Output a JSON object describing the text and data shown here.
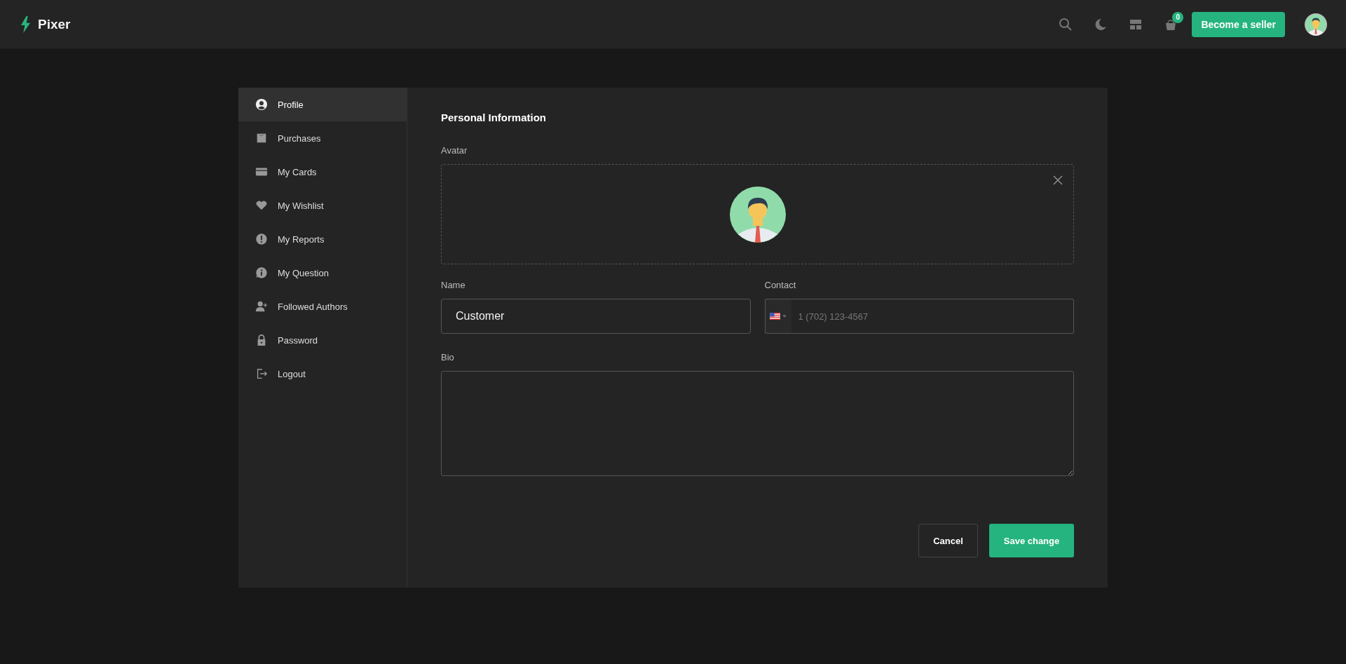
{
  "header": {
    "brand": "Pixer",
    "cart_count": "0",
    "seller_button": "Become a seller"
  },
  "sidebar": {
    "items": [
      {
        "label": "Profile",
        "selected": true
      },
      {
        "label": "Purchases",
        "selected": false
      },
      {
        "label": "My Cards",
        "selected": false
      },
      {
        "label": "My Wishlist",
        "selected": false
      },
      {
        "label": "My Reports",
        "selected": false
      },
      {
        "label": "My Question",
        "selected": false
      },
      {
        "label": "Followed Authors",
        "selected": false
      },
      {
        "label": "Password",
        "selected": false
      },
      {
        "label": "Logout",
        "selected": false
      }
    ]
  },
  "form": {
    "title": "Personal Information",
    "avatar_label": "Avatar",
    "name_label": "Name",
    "name_value": "Customer",
    "contact_label": "Contact",
    "contact_placeholder": "1 (702) 123-4567",
    "bio_label": "Bio",
    "cancel": "Cancel",
    "save": "Save change"
  }
}
